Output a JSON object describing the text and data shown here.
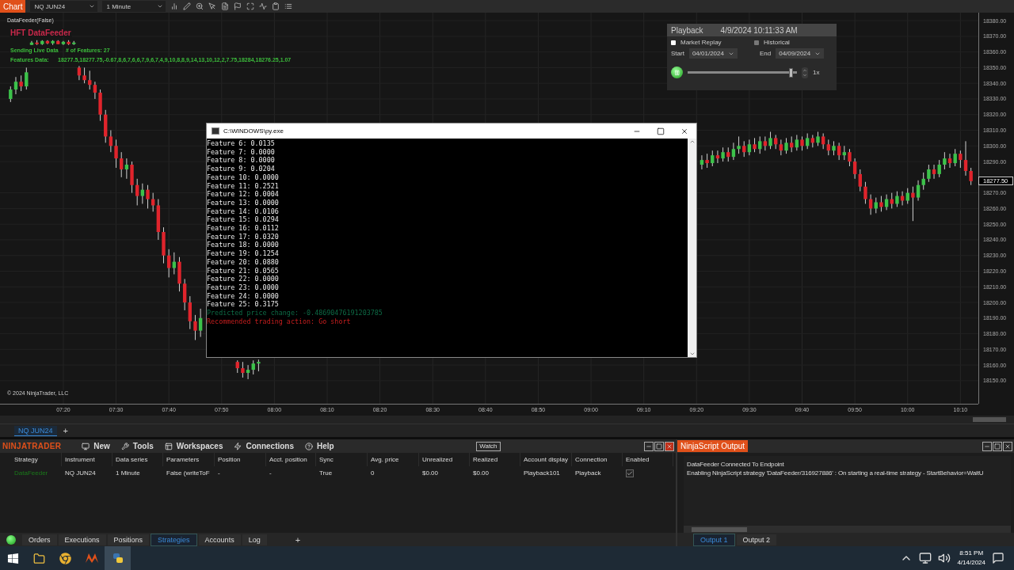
{
  "chart_window": {
    "tab_label": "Chart",
    "instrument": "NQ JUN24",
    "interval": "1 Minute"
  },
  "chart": {
    "indicator_label": "DataFeeder(False)",
    "overlay_title": "HFT DataFeeder",
    "status_lines": [
      {
        "label": "Sending Live Data",
        "value": "# of Features: 27"
      },
      {
        "label": "Features Data:",
        "value": "18277.5,18277.75,-0.67,8,6,7,6,6,7,9,6,7,4,9,10,8,8,9,14,13,10,12,2,7.75,18284,18276.25,1.07"
      }
    ],
    "copyright": "© 2024 NinjaTrader, LLC",
    "chart_data": {
      "type": "candlestick",
      "grid": true,
      "xlim": [
        428,
        613.4
      ],
      "ylim": [
        18135.3,
        18385.1
      ],
      "xticks": [
        {
          "value": 440,
          "label": "07:20"
        },
        {
          "value": 450,
          "label": "07:30"
        },
        {
          "value": 460,
          "label": "07:40"
        },
        {
          "value": 470,
          "label": "07:50"
        },
        {
          "value": 480,
          "label": "08:00"
        },
        {
          "value": 490,
          "label": "08:10"
        },
        {
          "value": 500,
          "label": "08:20"
        },
        {
          "value": 510,
          "label": "08:30"
        },
        {
          "value": 520,
          "label": "08:40"
        },
        {
          "value": 530,
          "label": "08:50"
        },
        {
          "value": 540,
          "label": "09:00"
        },
        {
          "value": 550,
          "label": "09:10"
        },
        {
          "value": 560,
          "label": "09:20"
        },
        {
          "value": 570,
          "label": "09:30"
        },
        {
          "value": 580,
          "label": "09:40"
        },
        {
          "value": 590,
          "label": "09:50"
        },
        {
          "value": 600,
          "label": "10:00"
        },
        {
          "value": 610,
          "label": "10:10"
        }
      ],
      "yticks": [
        {
          "value": 18380,
          "label": "18380.00"
        },
        {
          "value": 18370,
          "label": "18370.00"
        },
        {
          "value": 18360,
          "label": "18360.00"
        },
        {
          "value": 18350,
          "label": "18350.00"
        },
        {
          "value": 18340,
          "label": "18340.00"
        },
        {
          "value": 18330,
          "label": "18330.00"
        },
        {
          "value": 18320,
          "label": "18320.00"
        },
        {
          "value": 18310,
          "label": "18310.00"
        },
        {
          "value": 18300,
          "label": "18300.00"
        },
        {
          "value": 18290,
          "label": "18290.00"
        },
        {
          "value": 18270,
          "label": "18270.00"
        },
        {
          "value": 18260,
          "label": "18260.00"
        },
        {
          "value": 18250,
          "label": "18250.00"
        },
        {
          "value": 18240,
          "label": "18240.00"
        },
        {
          "value": 18230,
          "label": "18230.00"
        },
        {
          "value": 18220,
          "label": "18220.00"
        },
        {
          "value": 18210,
          "label": "18210.00"
        },
        {
          "value": 18200,
          "label": "18200.00"
        },
        {
          "value": 18190,
          "label": "18190.00"
        },
        {
          "value": 18180,
          "label": "18180.00"
        },
        {
          "value": 18170,
          "label": "18170.00"
        },
        {
          "value": 18160,
          "label": "18160.00"
        },
        {
          "value": 18150,
          "label": "18150.00"
        }
      ],
      "x": [
        430,
        431,
        432,
        433,
        434,
        435,
        436,
        437,
        438,
        439,
        440,
        441,
        442,
        443,
        444,
        445,
        446,
        447,
        448,
        449,
        450,
        451,
        452,
        453,
        454,
        455,
        456,
        457,
        458,
        459,
        460,
        461,
        462,
        463,
        464,
        465,
        466,
        473,
        474,
        475,
        476,
        477,
        561,
        562,
        563,
        564,
        565,
        566,
        567,
        568,
        569,
        570,
        571,
        572,
        573,
        574,
        575,
        576,
        577,
        578,
        579,
        580,
        581,
        582,
        583,
        584,
        585,
        586,
        587,
        588,
        589,
        590,
        591,
        592,
        593,
        594,
        595,
        596,
        597,
        598,
        599,
        600,
        601,
        602,
        603,
        604,
        605,
        606,
        607,
        608,
        609,
        610,
        611,
        612
      ],
      "ohlc": [
        [
          18330,
          18338,
          18328,
          18336
        ],
        [
          18336,
          18344,
          18333,
          18341
        ],
        [
          18341,
          18345,
          18335,
          18338
        ],
        [
          18338,
          18350,
          18336,
          18347
        ],
        [
          18364.5,
          18367,
          18364.5,
          18366
        ],
        [
          18366,
          18367.5,
          18364.5,
          18365
        ],
        [
          18365,
          18367.5,
          18364.5,
          18367
        ],
        [
          18367,
          18367.5,
          18365,
          18365.5
        ],
        [
          18365.5,
          18367.5,
          18364.5,
          18367
        ],
        [
          18367,
          18367.5,
          18365,
          18365
        ],
        [
          18365,
          18367,
          18364.5,
          18366.5
        ],
        [
          18366.5,
          18367.5,
          18364.5,
          18365
        ],
        [
          18365,
          18367,
          18364.5,
          18366
        ],
        [
          18350,
          18351,
          18342,
          18345
        ],
        [
          18345,
          18350,
          18340,
          18342
        ],
        [
          18342,
          18348,
          18336,
          18339
        ],
        [
          18339,
          18341,
          18330,
          18334
        ],
        [
          18334,
          18336,
          18316,
          18320
        ],
        [
          18320,
          18323,
          18302,
          18306
        ],
        [
          18306,
          18310,
          18296,
          18300
        ],
        [
          18300,
          18304,
          18286,
          18292
        ],
        [
          18292,
          18296,
          18280,
          18285
        ],
        [
          18285,
          18292,
          18279,
          18288
        ],
        [
          18288,
          18290,
          18270,
          18275
        ],
        [
          18275,
          18279,
          18262,
          18268
        ],
        [
          18268,
          18276,
          18263,
          18272
        ],
        [
          18272,
          18275,
          18260,
          18266
        ],
        [
          18266,
          18270,
          18258,
          18262
        ],
        [
          18262,
          18266,
          18240,
          18245
        ],
        [
          18245,
          18248,
          18225,
          18230
        ],
        [
          18230,
          18234,
          18216,
          18222
        ],
        [
          18222,
          18232,
          18218,
          18226
        ],
        [
          18226,
          18229,
          18207,
          18212
        ],
        [
          18212,
          18215,
          18195,
          18200
        ],
        [
          18200,
          18204,
          18183,
          18188
        ],
        [
          18188,
          18192,
          18176,
          18182
        ],
        [
          18182,
          18196,
          18178,
          18190
        ],
        [
          18162,
          18163,
          18155,
          18158
        ],
        [
          18158,
          18162,
          18152,
          18155
        ],
        [
          18155,
          18160,
          18151,
          18157
        ],
        [
          18157,
          18163,
          18154,
          18161
        ],
        [
          18161,
          18163.5,
          18156,
          18162
        ],
        [
          18288,
          18294,
          18285,
          18291
        ],
        [
          18291,
          18295,
          18286,
          18289
        ],
        [
          18289,
          18297,
          18287,
          18294
        ],
        [
          18294,
          18297,
          18289,
          18292
        ],
        [
          18292,
          18299,
          18290,
          18296
        ],
        [
          18296,
          18299,
          18290,
          18293
        ],
        [
          18293,
          18302,
          18291,
          18298
        ],
        [
          18298,
          18306,
          18295,
          18300
        ],
        [
          18300,
          18303,
          18293,
          18296
        ],
        [
          18296,
          18304,
          18294,
          18301
        ],
        [
          18301,
          18305,
          18296,
          18298
        ],
        [
          18298,
          18306,
          18295,
          18303
        ],
        [
          18303,
          18306,
          18297,
          18300
        ],
        [
          18300,
          18309,
          18298,
          18305
        ],
        [
          18305,
          18307,
          18298,
          18301
        ],
        [
          18301,
          18304,
          18294,
          18297
        ],
        [
          18297,
          18305,
          18295,
          18302
        ],
        [
          18302,
          18306,
          18296,
          18299
        ],
        [
          18299,
          18307,
          18297,
          18304
        ],
        [
          18304,
          18306,
          18297,
          18300
        ],
        [
          18300,
          18308,
          18298,
          18305
        ],
        [
          18305,
          18307,
          18299,
          18302
        ],
        [
          18302,
          18309,
          18300,
          18306
        ],
        [
          18306,
          18308,
          18298,
          18301
        ],
        [
          18301,
          18304,
          18294,
          18297
        ],
        [
          18297,
          18303,
          18294,
          18300
        ],
        [
          18300,
          18302,
          18291,
          18294
        ],
        [
          18294,
          18300,
          18291,
          18296
        ],
        [
          18296,
          18298,
          18287,
          18290
        ],
        [
          18290,
          18292,
          18279,
          18282
        ],
        [
          18282,
          18285,
          18271,
          18274
        ],
        [
          18274,
          18277,
          18263,
          18266
        ],
        [
          18266,
          18269,
          18256,
          18260
        ],
        [
          18260,
          18267,
          18257,
          18264
        ],
        [
          18264,
          18268,
          18258,
          18261
        ],
        [
          18261,
          18269,
          18259,
          18266
        ],
        [
          18266,
          18270,
          18260,
          18263
        ],
        [
          18263,
          18271,
          18261,
          18268
        ],
        [
          18268,
          18271,
          18262,
          18265
        ],
        [
          18265,
          18273,
          18263,
          18270
        ],
        [
          18270,
          18274,
          18252,
          18267
        ],
        [
          18267,
          18278,
          18265,
          18275
        ],
        [
          18275,
          18283,
          18272,
          18279
        ],
        [
          18279,
          18288,
          18277,
          18285
        ],
        [
          18285,
          18288,
          18279,
          18282
        ],
        [
          18282,
          18291,
          18280,
          18288
        ],
        [
          18288,
          18296,
          18285,
          18292
        ],
        [
          18292,
          18295,
          18286,
          18289
        ],
        [
          18289,
          18298,
          18287,
          18295
        ],
        [
          18295,
          18297,
          18286,
          18291
        ],
        [
          18291,
          18303,
          18281,
          18284
        ],
        [
          18284,
          18286,
          18275,
          18277.5
        ]
      ]
    }
  },
  "price_marker": {
    "label": "18277.50"
  },
  "chart_tabs": [
    {
      "label": "NQ JUN24",
      "selected": true
    }
  ],
  "chart_add_tab": "+",
  "playback": {
    "title": "Playback",
    "time": "4/9/2024 10:11:33 AM",
    "modes": [
      {
        "label": "Market Replay",
        "selected": true
      },
      {
        "label": "Historical",
        "selected": false
      }
    ],
    "start_label": "Start",
    "start": "04/01/2024",
    "end_label": "End",
    "end": "04/09/2024",
    "playing": true,
    "level": 0.95,
    "speed": "1x"
  },
  "console": {
    "title": "C:\\WINDOWS\\py.exe",
    "lines": [
      {
        "kind": "normal",
        "text": "Feature 6: 0.0135"
      },
      {
        "kind": "normal",
        "text": "Feature 7: 0.0000"
      },
      {
        "kind": "normal",
        "text": "Feature 8: 0.0000"
      },
      {
        "kind": "normal",
        "text": "Feature 9: 0.0204"
      },
      {
        "kind": "normal",
        "text": "Feature 10: 0.0000"
      },
      {
        "kind": "normal",
        "text": "Feature 11: 0.2521"
      },
      {
        "kind": "normal",
        "text": "Feature 12: 0.0004"
      },
      {
        "kind": "normal",
        "text": "Feature 13: 0.0000"
      },
      {
        "kind": "normal",
        "text": "Feature 14: 0.0106"
      },
      {
        "kind": "normal",
        "text": "Feature 15: 0.0294"
      },
      {
        "kind": "normal",
        "text": "Feature 16: 0.0112"
      },
      {
        "kind": "normal",
        "text": "Feature 17: 0.0320"
      },
      {
        "kind": "normal",
        "text": "Feature 18: 0.0000"
      },
      {
        "kind": "normal",
        "text": "Feature 19: 0.1254"
      },
      {
        "kind": "normal",
        "text": "Feature 20: 0.0880"
      },
      {
        "kind": "normal",
        "text": "Feature 21: 0.0565"
      },
      {
        "kind": "normal",
        "text": "Feature 22: 0.0000"
      },
      {
        "kind": "normal",
        "text": "Feature 23: 0.0000"
      },
      {
        "kind": "normal",
        "text": "Feature 24: 0.0000"
      },
      {
        "kind": "normal",
        "text": "Feature 25: 0.3175"
      },
      {
        "kind": "prediction",
        "text": "Predicted price change: -0.48690476191203785"
      },
      {
        "kind": "action",
        "text": "Recommended trading action: Go short"
      }
    ]
  },
  "control_center": {
    "logo": "NINJATRADER",
    "menu": [
      "New",
      "Tools",
      "Workspaces",
      "Connections",
      "Help"
    ],
    "watch": "Watch",
    "columns": [
      "Strategy",
      "Instrument",
      "Data series",
      "Parameters",
      "Position",
      "Acct. position",
      "Sync",
      "Avg. price",
      "Unrealized",
      "Realized",
      "Account display",
      "Connection",
      "Enabled"
    ],
    "rows": [
      {
        "cells": [
          "DataFeeder",
          "NQ JUN24",
          "1 Minute",
          "False (writeToF",
          "-",
          "-",
          "True",
          "0",
          "$0.00",
          "$0.00",
          "Playback101",
          "Playback"
        ],
        "enabled": true
      }
    ],
    "tabs": [
      {
        "label": "Orders",
        "selected": false
      },
      {
        "label": "Executions",
        "selected": false
      },
      {
        "label": "Positions",
        "selected": false
      },
      {
        "label": "Strategies",
        "selected": true
      },
      {
        "label": "Accounts",
        "selected": false
      },
      {
        "label": "Log",
        "selected": false
      }
    ],
    "add_tab": "+"
  },
  "output": {
    "title": "NinjaScript Output",
    "lines": [
      "DataFeeder Connected To Endpoint",
      "Enabling NinjaScript strategy 'DataFeeder/316927886' : On starting a real-time strategy - StartBehavior=WaitU"
    ],
    "tabs": [
      {
        "label": "Output 1",
        "selected": true
      },
      {
        "label": "Output 2",
        "selected": false
      }
    ]
  },
  "taskbar": {
    "time": "8:51 PM",
    "date": "4/14/2024"
  }
}
